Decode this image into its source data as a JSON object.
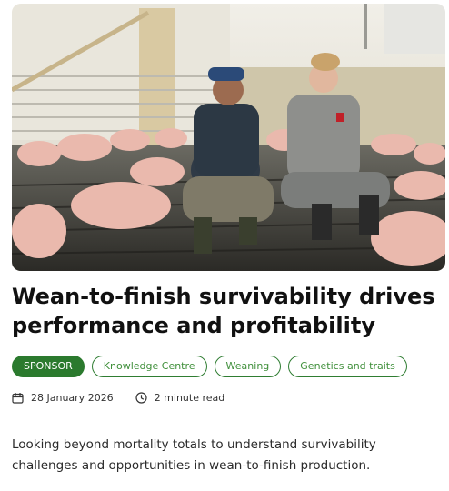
{
  "article": {
    "image_alt_icon": "photo",
    "title": "Wean-to-finish survivability drives performance and profitability",
    "tags": [
      "SPONSOR",
      "Knowledge Centre",
      "Weaning",
      "Genetics and traits"
    ],
    "date": "28 January 2026",
    "read_time": "2 minute read",
    "description": "Looking beyond mortality totals to understand survivability challenges and opportunities in wean-to-finish production."
  },
  "colors": {
    "sponsor_bg": "#2b7a2e",
    "tag_border": "#2f7d32",
    "tag_text": "#3f8f3a"
  }
}
